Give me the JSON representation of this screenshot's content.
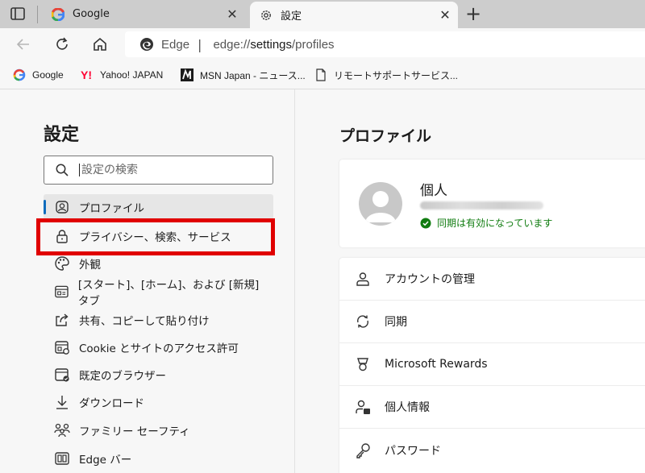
{
  "tabs": [
    {
      "title": "Google",
      "favicon": "google-icon"
    },
    {
      "title": "設定",
      "favicon": "gear-icon"
    }
  ],
  "address": {
    "site": "Edge",
    "separator": "|",
    "url_prefix": "edge://",
    "url_bold": "settings",
    "url_suffix": "/profiles"
  },
  "favorites": [
    {
      "label": "Google",
      "icon": "google-icon"
    },
    {
      "label": "Yahoo! JAPAN",
      "icon": "yahoo-icon"
    },
    {
      "label": "MSN Japan - ニュース...",
      "icon": "msn-icon"
    },
    {
      "label": "リモートサポートサービス...",
      "icon": "document-icon"
    }
  ],
  "sidebar": {
    "title": "設定",
    "search_placeholder": "設定の検索",
    "items": [
      {
        "label": "プロファイル",
        "icon": "profile-icon",
        "active": true
      },
      {
        "label": "プライバシー、検索、サービス",
        "icon": "lock-icon"
      },
      {
        "label": "外観",
        "icon": "palette-icon"
      },
      {
        "label": "[スタート]、[ホーム]、および [新規] タブ",
        "icon": "home-grid-icon"
      },
      {
        "label": "共有、コピーして貼り付け",
        "icon": "share-icon"
      },
      {
        "label": "Cookie とサイトのアクセス許可",
        "icon": "site-permissions-icon"
      },
      {
        "label": "既定のブラウザー",
        "icon": "default-browser-icon"
      },
      {
        "label": "ダウンロード",
        "icon": "download-icon"
      },
      {
        "label": "ファミリー セーフティ",
        "icon": "family-icon"
      },
      {
        "label": "Edge バー",
        "icon": "edge-bar-icon"
      }
    ]
  },
  "main": {
    "title": "プロファイル",
    "profile": {
      "name": "個人",
      "sync_status": "同期は有効になっています"
    },
    "menu": [
      {
        "label": "アカウントの管理",
        "icon": "account-icon"
      },
      {
        "label": "同期",
        "icon": "sync-icon"
      },
      {
        "label": "Microsoft Rewards",
        "icon": "rewards-icon"
      },
      {
        "label": "個人情報",
        "icon": "personal-info-icon"
      },
      {
        "label": "パスワード",
        "icon": "key-icon"
      }
    ]
  },
  "colors": {
    "highlight": "#e00000",
    "accent": "#0f6cbd",
    "sync_green": "#107c10"
  }
}
